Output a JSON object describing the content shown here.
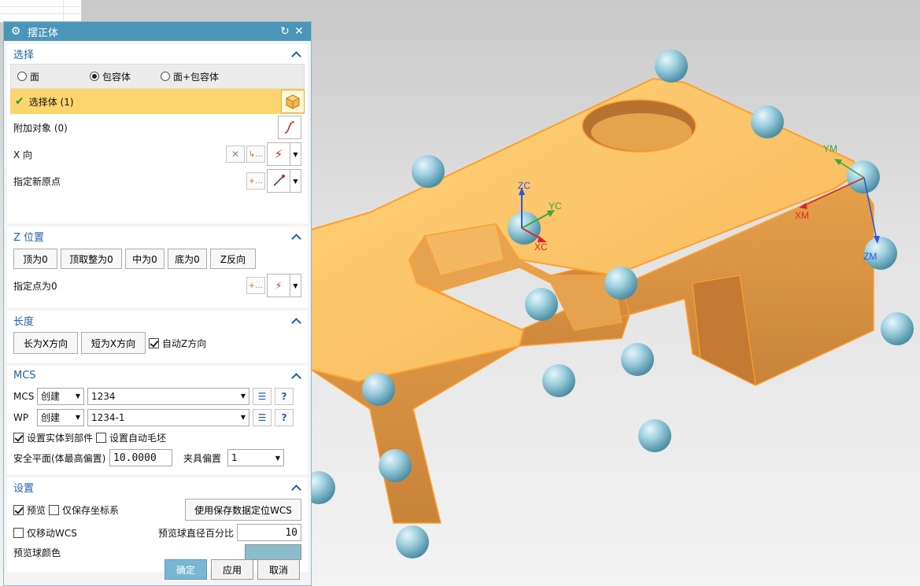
{
  "dialog": {
    "title": "摆正体",
    "icons": {
      "app": "gear-icon",
      "reset": "reset-icon",
      "close": "close-icon"
    }
  },
  "select_section": {
    "title": "选择",
    "radios": [
      {
        "label": "面",
        "checked": false
      },
      {
        "label": "包容体",
        "checked": true
      },
      {
        "label": "面+包容体",
        "checked": false
      }
    ],
    "select_body": "选择体 (1)",
    "attach": "附加对象 (0)",
    "x_dir": "X 向",
    "new_origin": "指定新原点"
  },
  "z_section": {
    "title": "Z 位置",
    "buttons": [
      "顶为0",
      "顶取整为0",
      "中为0",
      "底为0",
      "Z反向"
    ],
    "point": "指定点为0"
  },
  "length_section": {
    "title": "长度",
    "long_btn": "长为X方向",
    "short_btn": "短为X方向",
    "auto_z": "自动Z方向",
    "auto_z_checked": true
  },
  "mcs_section": {
    "title": "MCS",
    "mcs_label": "MCS",
    "mcs_mode": "创建",
    "mcs_name": "1234",
    "wp_label": "WP",
    "wp_mode": "创建",
    "wp_name": "1234-1",
    "set_solid": "设置实体到部件",
    "set_solid_checked": true,
    "set_blank": "设置自动毛坯",
    "set_blank_checked": false,
    "safe_plane_label": "安全平面(体最高偏置)",
    "safe_plane_value": "10.0000",
    "fixture_label": "夹具偏置",
    "fixture_value": "1"
  },
  "settings_section": {
    "title": "设置",
    "preview": "预览",
    "preview_checked": true,
    "save_csys_only": "仅保存坐标系",
    "save_csys_checked": false,
    "use_saved": "使用保存数据定位WCS",
    "move_wcs_only": "仅移动WCS",
    "move_wcs_checked": false,
    "ball_pct_label": "预览球直径百分比",
    "ball_pct_value": "10",
    "ball_color_label": "预览球颜色",
    "ball_color": "#8bbccc"
  },
  "footer": {
    "ok": "确定",
    "apply": "应用",
    "cancel": "取消"
  },
  "axes": {
    "zc": "ZC",
    "yc": "YC",
    "xc": "XC",
    "ym": "YM",
    "xm": "XM",
    "zm": "ZM"
  },
  "colors": {
    "part": "#f6b85a",
    "part_dark": "#e0953a",
    "edge": "#ff9f2e",
    "sphere": "#8fc4d6",
    "title_bar": "#4b95b8"
  }
}
